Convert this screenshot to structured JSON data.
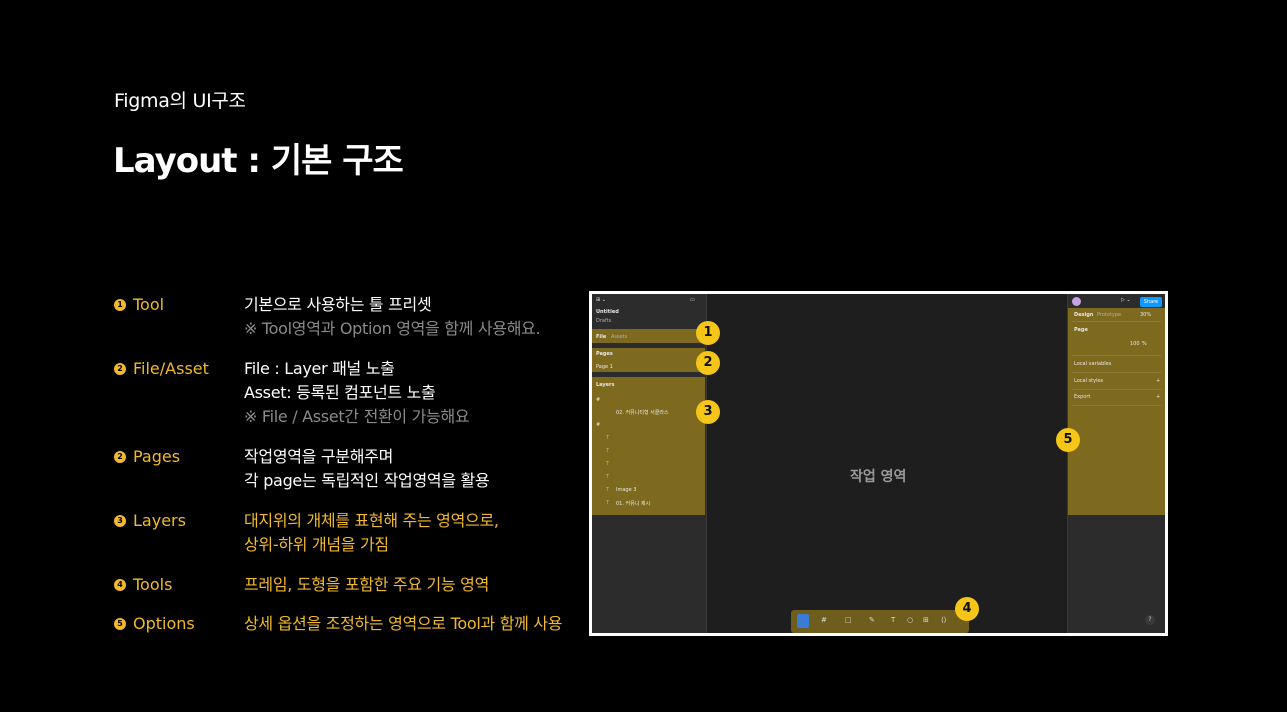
{
  "header": {
    "subtitle": "Figma의 UI구조",
    "title": "Layout : 기본 구조"
  },
  "legend": [
    {
      "num": "1",
      "label": "Tool",
      "lines": [
        "기본으로 사용하는 툴 프리셋"
      ],
      "note": "※ Tool영역과 Option 영역을 함께 사용해요."
    },
    {
      "num": "2",
      "label": "File/Asset",
      "lines": [
        "File : Layer 패널 노출",
        "Asset: 등록된 컴포넌트 노출"
      ],
      "note": "※ File / Asset간 전환이 가능해요"
    },
    {
      "num": "2",
      "label": "Pages",
      "lines": [
        "작업영역을 구분해주며",
        "각 page는 독립적인 작업영역을 활용"
      ],
      "note": ""
    },
    {
      "num": "3",
      "label": "Layers",
      "lines": [
        "대지위의 개체를 표현해 주는 영역으로,",
        "상위-하위 개념을 가짐"
      ],
      "note": ""
    },
    {
      "num": "4",
      "label": "Tools",
      "lines": [
        "프레임, 도형을 포함한 주요 기능 영역"
      ],
      "note": ""
    },
    {
      "num": "5",
      "label": "Options",
      "lines": [
        "상세 옵션을 조정하는 영역으로 Tool과 함께 사용"
      ],
      "note": ""
    }
  ],
  "mockup": {
    "canvas_label": "작업 영역",
    "file_name": "Untitled",
    "file_sub": "Drafts",
    "tab_file": "File",
    "tab_assets": "Assets",
    "pages_heading": "Pages",
    "page_item": "Page 1",
    "layers_heading": "Layers",
    "layers": [
      "#",
      "02. 커뮤니티형 서클라스",
      "#",
      "T",
      "T",
      "T",
      "T",
      "T",
      "Image 3",
      "T",
      "01. 커뮤니 제시"
    ],
    "design_tab": "Design",
    "prototype_tab": "Prototype",
    "zoom": "30%",
    "page_label": "Page",
    "page_opacity": "100",
    "page_unit": "%",
    "local_variables": "Local variables",
    "local_styles": "Local styles",
    "export": "Export",
    "share": "Share",
    "help": "?",
    "badges": [
      "1",
      "2",
      "3",
      "4",
      "5"
    ]
  },
  "colors": {
    "accent": "#f2b92b",
    "highlight": "#9e8219",
    "note": "#8a8a8a"
  }
}
